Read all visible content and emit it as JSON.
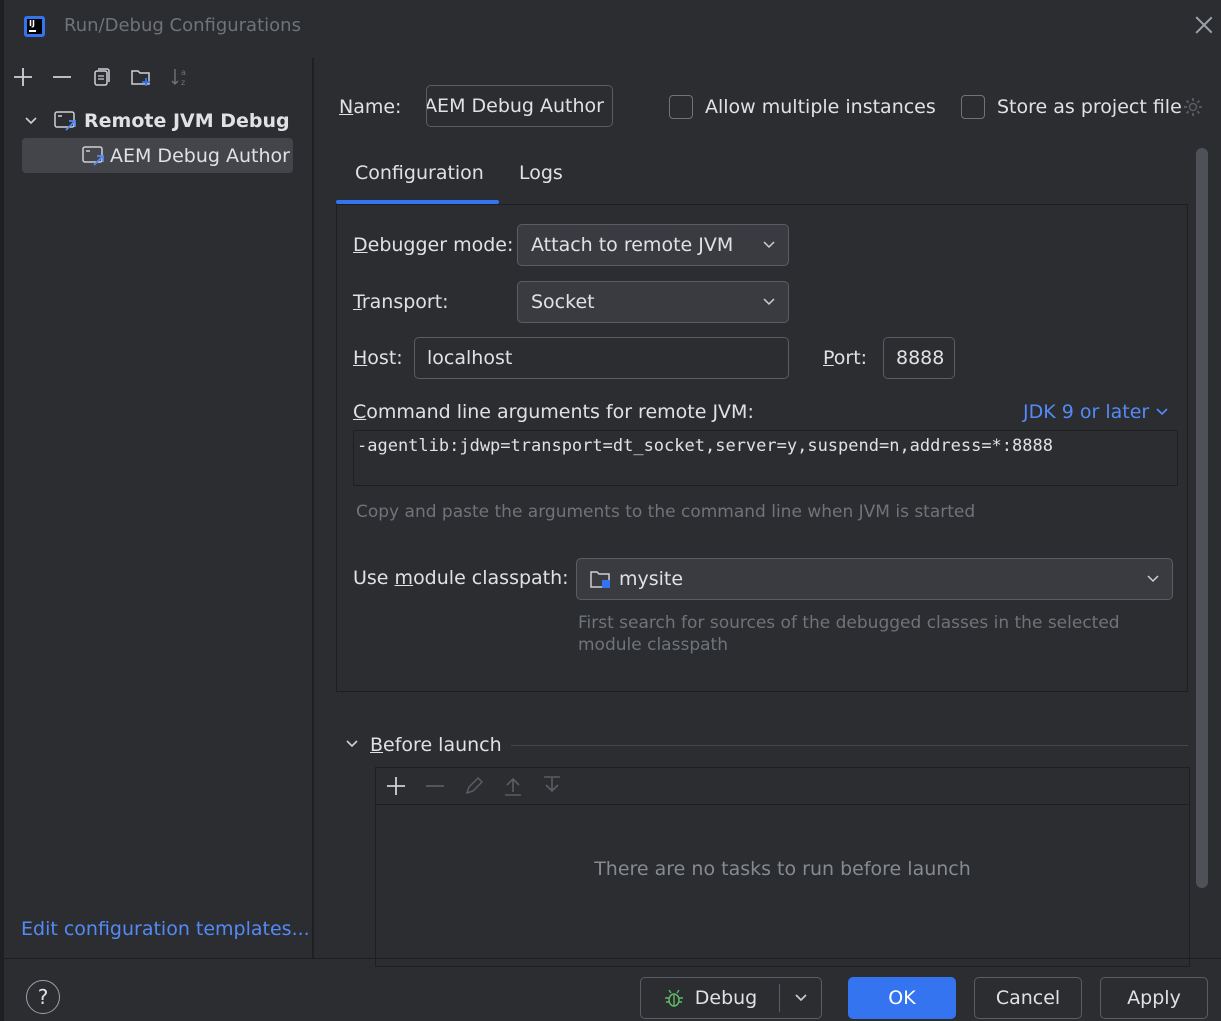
{
  "window": {
    "title": "Run/Debug Configurations"
  },
  "left": {
    "tree": {
      "group_label": "Remote JVM Debug",
      "item_label": "AEM Debug Author"
    },
    "edit_templates_label": "Edit configuration templates..."
  },
  "form": {
    "name_label_first": "N",
    "name_label_rest": "ame:",
    "name_value": "AEM Debug Author",
    "allow_multiple_label": "Allow multiple instances",
    "store_as_project_label": "Store as project file",
    "tabs": [
      {
        "label": "Configuration"
      },
      {
        "label": "Logs"
      }
    ],
    "debugger_mode_label_first": "D",
    "debugger_mode_label_rest": "ebugger mode:",
    "debugger_mode_value": "Attach to remote JVM",
    "transport_label_first": "T",
    "transport_label_rest": "ransport:",
    "transport_value": "Socket",
    "host_label_first": "H",
    "host_label_rest": "ost:",
    "host_value": "localhost",
    "port_label_first": "P",
    "port_label_rest": "ort:",
    "port_value": "8888",
    "cmd_label_first": "C",
    "cmd_label_rest": "ommand line arguments for remote JVM:",
    "jdk_link": "JDK 9 or later",
    "cmd_args": "-agentlib:jdwp=transport=dt_socket,server=y,suspend=n,address=*:8888",
    "cmd_hint": "Copy and paste the arguments to the command line when JVM is started",
    "module_label_a": "Use ",
    "module_label_u": "m",
    "module_label_b": "odule classpath:",
    "module_value": "mysite",
    "module_hint_1": "First search for sources of the debugged classes in the selected",
    "module_hint_2": "module classpath",
    "before_launch_first": "B",
    "before_launch_rest": "efore launch",
    "before_launch_empty": "There are no tasks to run before launch"
  },
  "buttons": {
    "help": "?",
    "debug": "Debug",
    "ok": "OK",
    "cancel": "Cancel",
    "apply": "Apply"
  },
  "colors": {
    "accent": "#3574f0",
    "link": "#548af7",
    "background": "#2b2d30"
  }
}
